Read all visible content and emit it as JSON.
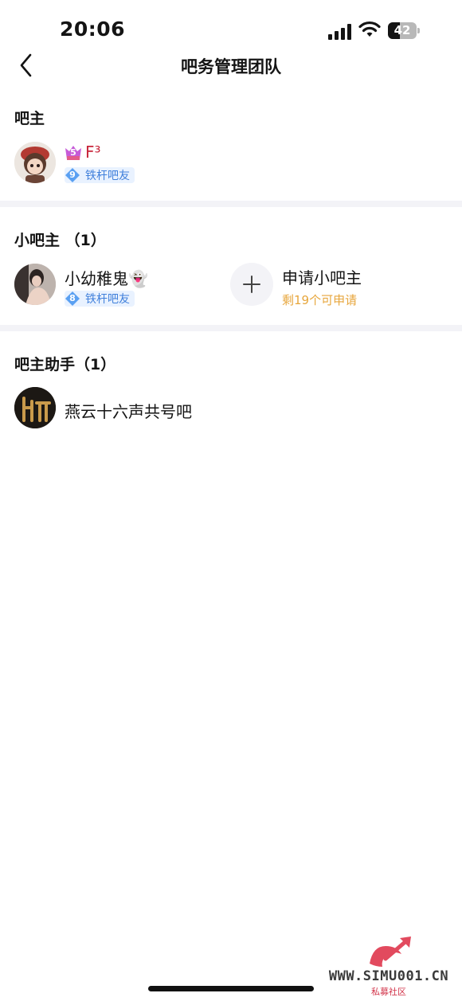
{
  "status_bar": {
    "time": "20:06",
    "battery": "42",
    "battery_level": 0.42
  },
  "nav": {
    "title": "吧务管理团队"
  },
  "owner_section": {
    "title": "吧主",
    "member": {
      "name": "F³",
      "level": "9",
      "level_title": "铁杆吧友",
      "vip_level": "5"
    }
  },
  "mini_owner_section": {
    "title": "小吧主 （1）",
    "member": {
      "name": "小幼稚鬼👻",
      "level": "8",
      "level_title": "铁杆吧友"
    },
    "apply": {
      "label": "申请小吧主",
      "remaining": "剩19个可申请"
    }
  },
  "assistant_section": {
    "title": "吧主助手（1）",
    "member": {
      "name": "燕云十六声共号吧"
    }
  },
  "watermark": {
    "text": "WWW.SIMU001.CN",
    "sub": "私募社区"
  },
  "colors": {
    "accent_blue": "#3f7fdb",
    "orange": "#e7a63c",
    "owner_red": "#c8253a",
    "divider": "#f3f3f7"
  }
}
